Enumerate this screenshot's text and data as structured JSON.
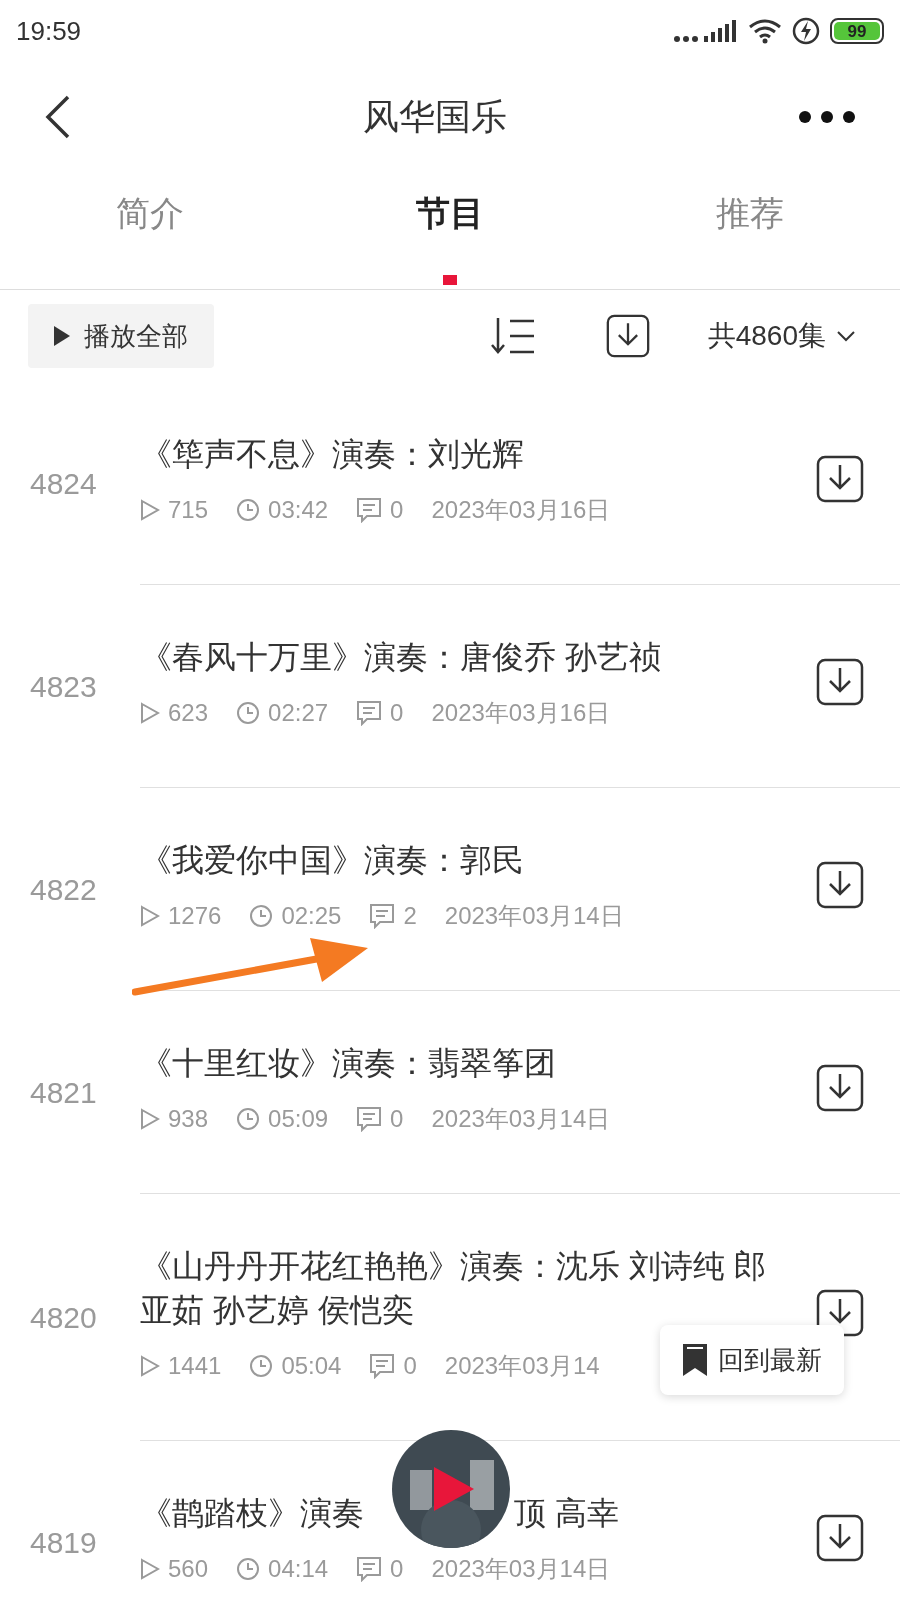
{
  "status_bar": {
    "time": "19:59",
    "battery": "99"
  },
  "header": {
    "title": "风华国乐"
  },
  "tabs": [
    {
      "label": "简介",
      "selected": false
    },
    {
      "label": "节目",
      "selected": true
    },
    {
      "label": "推荐",
      "selected": false
    }
  ],
  "toolbar": {
    "play_all": "播放全部",
    "total": "共4860集"
  },
  "episodes": [
    {
      "number": "4824",
      "title": "《筚声不息》演奏：刘光辉",
      "plays": "715",
      "duration": "03:42",
      "comments": "0",
      "date": "2023年03月16日"
    },
    {
      "number": "4823",
      "title": "《春风十万里》演奏：唐俊乔 孙艺祯",
      "plays": "623",
      "duration": "02:27",
      "comments": "0",
      "date": "2023年03月16日"
    },
    {
      "number": "4822",
      "title": "《我爱你中国》演奏：郭民",
      "plays": "1276",
      "duration": "02:25",
      "comments": "2",
      "date": "2023年03月14日"
    },
    {
      "number": "4821",
      "title": "《十里红妆》演奏：翡翠筝团",
      "plays": "938",
      "duration": "05:09",
      "comments": "0",
      "date": "2023年03月14日"
    },
    {
      "number": "4820",
      "title": "《山丹丹开花红艳艳》演奏：沈乐 刘诗纯 郎亚茹 孙艺婷 侯恺奕",
      "plays": "1441",
      "duration": "05:04",
      "comments": "0",
      "date": "2023年03月14"
    },
    {
      "number": "4819",
      "title": "《鹊踏枝》演奏",
      "title_tail": "顶 高幸",
      "plays": "560",
      "duration": "04:14",
      "comments": "0",
      "date": "2023年03月14日"
    }
  ],
  "back_to_latest": "回到最新"
}
